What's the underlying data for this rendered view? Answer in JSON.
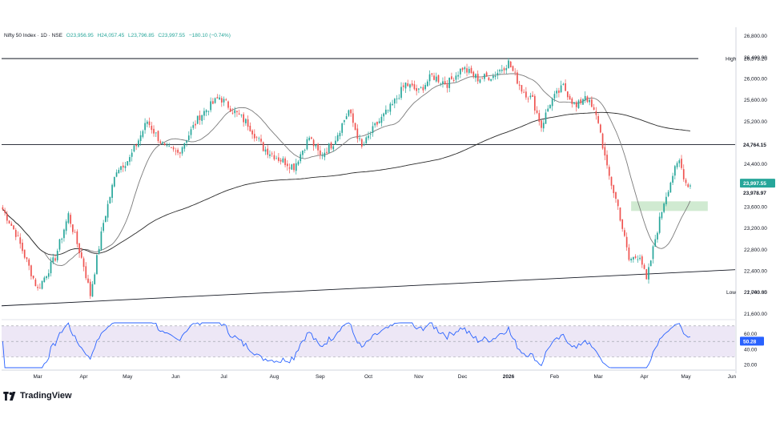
{
  "brand": {
    "name": "TradingView",
    "logo_icon": "tradingview-logo-icon"
  },
  "colors": {
    "up": "#26a69a",
    "down": "#ef5350",
    "trendline": "#131722",
    "ma_fast": "#7b7b7b",
    "ma_slow": "#2b2b2b",
    "rsi_line": "#2962ff",
    "rsi_band": "#ede7f6",
    "zone": "#c8e6c9",
    "last_price_bg": "#26a69a",
    "level_bg": "#131722"
  },
  "chart_data": [
    {
      "type": "candlestick",
      "header": {
        "symbol": "Nifty 50 Index · 1D · NSE",
        "open": "O23,956.95",
        "high": "H24,057.45",
        "low": "L23,796.85",
        "close": "C23,997.55",
        "change": "−180.10 (−0.74%)"
      },
      "ylim": [
        21500,
        26900
      ],
      "y_ticks": [
        21600,
        22000,
        22400,
        22800,
        23200,
        23600,
        24000,
        24400,
        24800,
        25200,
        25600,
        26000,
        26400,
        26800
      ],
      "y_tick_labels": [
        "21,600.00",
        "22,000.00",
        "22,400.00",
        "22,800.00",
        "23,200.00",
        "23,600.00",
        "24,000.00",
        "24,400.00",
        "24,800.00",
        "25,200.00",
        "25,600.00",
        "26,000.00",
        "26,400.00",
        "26,800.00"
      ],
      "x_labels": [
        {
          "label": "Mar",
          "index": 16
        },
        {
          "label": "Apr",
          "index": 37
        },
        {
          "label": "May",
          "index": 57
        },
        {
          "label": "Jun",
          "index": 79
        },
        {
          "label": "Jul",
          "index": 101
        },
        {
          "label": "Aug",
          "index": 124
        },
        {
          "label": "Sep",
          "index": 145
        },
        {
          "label": "Oct",
          "index": 167
        },
        {
          "label": "Nov",
          "index": 190
        },
        {
          "label": "Dec",
          "index": 210
        },
        {
          "label": "2026",
          "index": 231
        },
        {
          "label": "Feb",
          "index": 252
        },
        {
          "label": "Mar",
          "index": 272
        },
        {
          "label": "Apr",
          "index": 293
        },
        {
          "label": "May",
          "index": 312
        },
        {
          "label": "Jun",
          "index": 333
        }
      ],
      "high_label": {
        "text": "High",
        "value": "26,373.20",
        "index": 235
      },
      "low_label": {
        "text": "Low",
        "value": "21,743.65"
      },
      "level_label": {
        "value": "24,764.15"
      },
      "last_price_label": {
        "value": "23,997.55"
      },
      "ma_price_label": {
        "value": "23,978.97"
      },
      "levels": [
        26373.2,
        24764.15
      ],
      "trendline": [
        {
          "index": 0,
          "value": 21743.65
        },
        {
          "index": 340,
          "value": 22420
        }
      ],
      "demand_zone": {
        "from_index": 287,
        "to_index": 322,
        "low": 23520,
        "high": 23700
      },
      "anchors": [
        [
          0,
          23550
        ],
        [
          6,
          23100
        ],
        [
          16,
          22050
        ],
        [
          24,
          22650
        ],
        [
          30,
          23450
        ],
        [
          37,
          22500
        ],
        [
          40,
          21950
        ],
        [
          46,
          23300
        ],
        [
          52,
          24300
        ],
        [
          58,
          24500
        ],
        [
          66,
          25200
        ],
        [
          74,
          24700
        ],
        [
          80,
          24600
        ],
        [
          90,
          25300
        ],
        [
          99,
          25650
        ],
        [
          104,
          25450
        ],
        [
          112,
          25150
        ],
        [
          119,
          24700
        ],
        [
          126,
          24500
        ],
        [
          133,
          24350
        ],
        [
          140,
          24900
        ],
        [
          145,
          24550
        ],
        [
          151,
          24800
        ],
        [
          158,
          25400
        ],
        [
          164,
          24700
        ],
        [
          170,
          25100
        ],
        [
          178,
          25500
        ],
        [
          184,
          25900
        ],
        [
          190,
          25750
        ],
        [
          196,
          26050
        ],
        [
          203,
          25900
        ],
        [
          210,
          26200
        ],
        [
          217,
          26000
        ],
        [
          224,
          26050
        ],
        [
          231,
          26300
        ],
        [
          237,
          25800
        ],
        [
          242,
          25600
        ],
        [
          246,
          25100
        ],
        [
          250,
          25550
        ],
        [
          256,
          25850
        ],
        [
          262,
          25450
        ],
        [
          266,
          25700
        ],
        [
          272,
          25200
        ],
        [
          276,
          24300
        ],
        [
          281,
          23600
        ],
        [
          286,
          22600
        ],
        [
          291,
          22700
        ],
        [
          294,
          22200
        ],
        [
          298,
          23000
        ],
        [
          302,
          23700
        ],
        [
          306,
          24200
        ],
        [
          309,
          24450
        ],
        [
          312,
          24050
        ],
        [
          314,
          23997.55
        ]
      ],
      "n_bars": 315,
      "moving_averages": [
        {
          "kind": "fast",
          "window": 20
        },
        {
          "kind": "slow",
          "window": 200
        }
      ]
    },
    {
      "type": "line",
      "indicator": "RSI",
      "value_label": "50.28",
      "ylim": [
        15,
        75
      ],
      "y_ticks": [
        20,
        40,
        60
      ],
      "y_tick_labels": [
        "20.00",
        "40.00",
        "60.00"
      ],
      "band": [
        30,
        70
      ],
      "midline": 50
    }
  ]
}
